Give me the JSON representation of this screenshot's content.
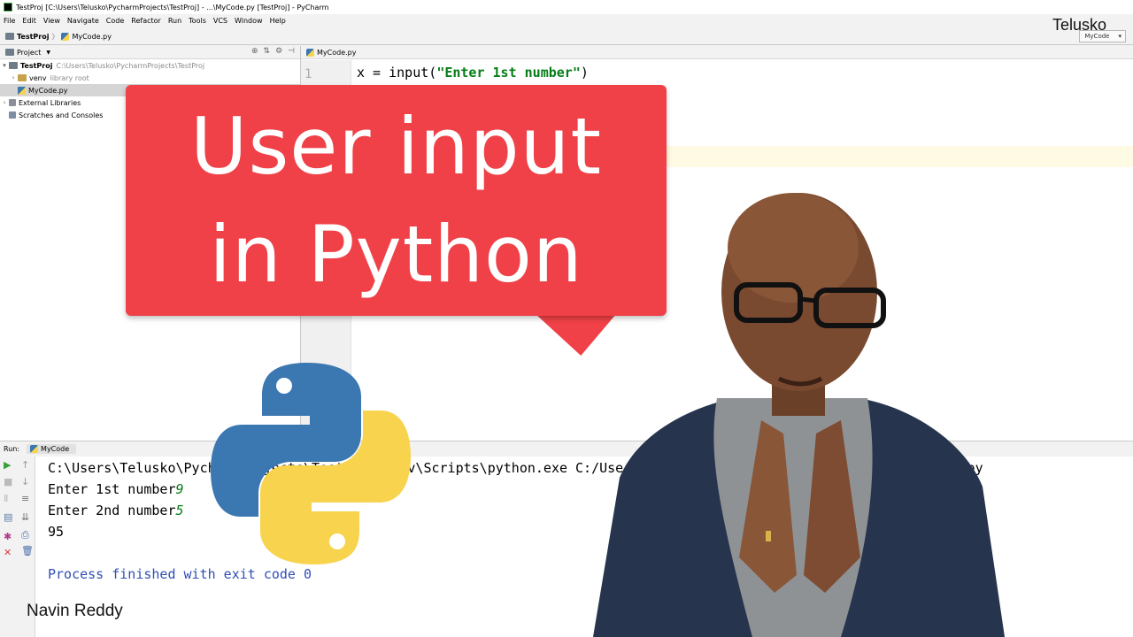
{
  "window": {
    "title": "TestProj [C:\\Users\\Telusko\\PycharmProjects\\TestProj] - ...\\MyCode.py [TestProj] - PyCharm"
  },
  "menu": [
    "File",
    "Edit",
    "View",
    "Navigate",
    "Code",
    "Refactor",
    "Run",
    "Tools",
    "VCS",
    "Window",
    "Help"
  ],
  "breadcrumb": {
    "project": "TestProj",
    "file": "MyCode.py",
    "run_config": "MyCode"
  },
  "brand": "Telusko",
  "project_panel": {
    "header": "Project",
    "tree": [
      {
        "label": "TestProj",
        "hint": "C:\\Users\\Telusko\\PycharmProjects\\TestProj"
      },
      {
        "label": "venv",
        "hint": "library root"
      },
      {
        "label": "MyCode.py",
        "hint": ""
      },
      {
        "label": "External Libraries",
        "hint": ""
      },
      {
        "label": "Scratches and Consoles",
        "hint": ""
      }
    ]
  },
  "editor": {
    "tab": "MyCode.py",
    "line_number": "1",
    "code_prefix": "x = input(",
    "code_string": "\"Enter 1st number\"",
    "code_suffix": ")"
  },
  "run_panel": {
    "label": "Run:",
    "tab": "MyCode",
    "console": {
      "path_line": "C:\\Users\\Telusko\\PycharmProjects\\TestProj\\venv\\Scripts\\python.exe C:/Users/Telusko/PycharmProjects/TestProj/MyCode.py",
      "prompt1": "Enter 1st number",
      "input1": "9",
      "prompt2": "Enter 2nd number",
      "input2": "5",
      "output": "95",
      "finished": "Process finished with exit code 0"
    }
  },
  "overlay": {
    "headline_line1": "User input",
    "headline_line2": "in Python",
    "author": "Navin Reddy",
    "bubble_color": "#ef4147"
  }
}
